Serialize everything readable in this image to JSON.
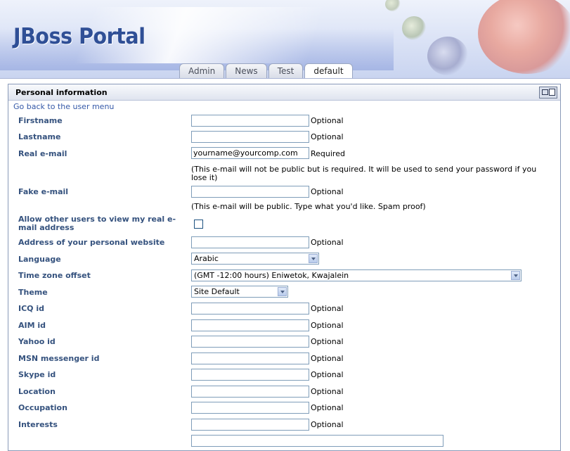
{
  "header": {
    "logo": "JBoss Portal"
  },
  "tabs": [
    {
      "label": "Admin"
    },
    {
      "label": "News"
    },
    {
      "label": "Test"
    },
    {
      "label": "default"
    }
  ],
  "window": {
    "title": "Personal information",
    "back_link": "Go back to the user menu"
  },
  "form": {
    "firstname": {
      "label": "Firstname",
      "value": "",
      "note": "Optional"
    },
    "lastname": {
      "label": "Lastname",
      "value": "",
      "note": "Optional"
    },
    "real_email": {
      "label": "Real e-mail",
      "value": "yourname@yourcomp.com",
      "note": "Required",
      "help": "(This e-mail will not be public but is required. It will be used to send your password if you lose it)"
    },
    "fake_email": {
      "label": "Fake e-mail",
      "value": "",
      "note": "Optional",
      "help": "(This e-mail will be public. Type what you'd like. Spam proof)"
    },
    "allow_view": {
      "label": "Allow other users to view my real e-mail address",
      "checked": false
    },
    "website": {
      "label": "Address of your personal website",
      "value": "",
      "note": "Optional"
    },
    "language": {
      "label": "Language",
      "selected": "Arabic"
    },
    "timezone": {
      "label": "Time zone offset",
      "selected": "(GMT -12:00 hours) Eniwetok, Kwajalein"
    },
    "theme": {
      "label": "Theme",
      "selected": "Site Default"
    },
    "icq": {
      "label": "ICQ id",
      "value": "",
      "note": "Optional"
    },
    "aim": {
      "label": "AIM id",
      "value": "",
      "note": "Optional"
    },
    "yahoo": {
      "label": "Yahoo id",
      "value": "",
      "note": "Optional"
    },
    "msn": {
      "label": "MSN messenger id",
      "value": "",
      "note": "Optional"
    },
    "skype": {
      "label": "Skype id",
      "value": "",
      "note": "Optional"
    },
    "location": {
      "label": "Location",
      "value": "",
      "note": "Optional"
    },
    "occupation": {
      "label": "Occupation",
      "value": "",
      "note": "Optional"
    },
    "interests": {
      "label": "Interests",
      "value": "",
      "note": "Optional"
    }
  }
}
